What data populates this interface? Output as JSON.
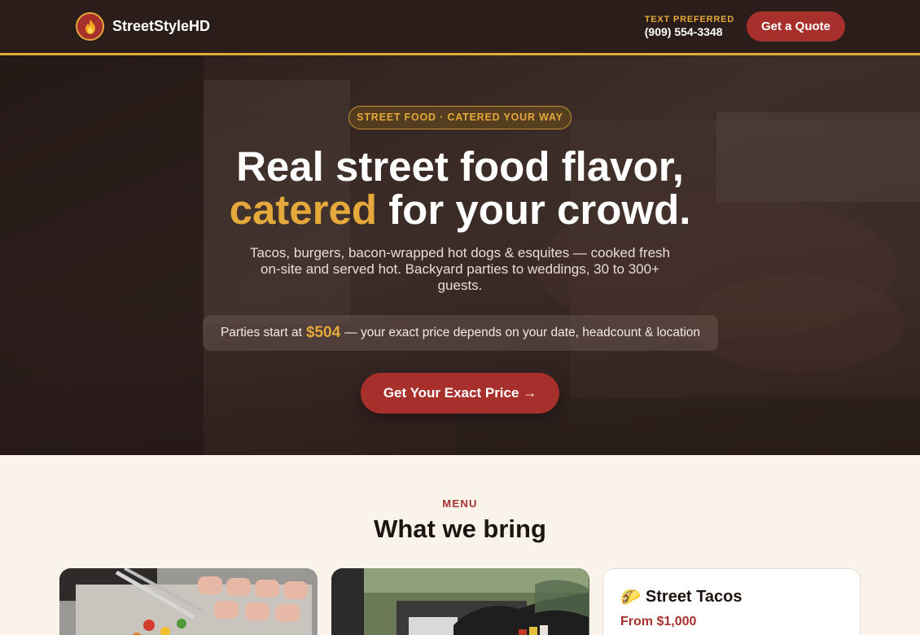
{
  "nav": {
    "brand": "StreetStyleHD",
    "text_label": "TEXT PREFERRED",
    "phone": "(909) 554-3348",
    "quote_button": "Get a Quote"
  },
  "hero": {
    "pill": "STREET FOOD · CATERED YOUR WAY",
    "headline_line1": "Real street food flavor,",
    "headline_accent": "catered",
    "headline_line2_rest": " for your crowd.",
    "subtext": "Tacos, burgers, bacon-wrapped hot dogs & esquites — cooked fresh on-site and served hot. Backyard parties to weddings, 30 to 300+ guests.",
    "price_prefix": "Parties start at",
    "price_amount": "$504",
    "price_suffix": "— your exact price depends on your date, headcount & location",
    "cta": "Get Your Exact Price →"
  },
  "menu": {
    "label": "MENU",
    "title": "What we bring",
    "cards": [
      {
        "type": "image",
        "icon": "grill-food-photo"
      },
      {
        "type": "image",
        "icon": "chef-serving-photo"
      },
      {
        "type": "text",
        "emoji": "🌮",
        "title": "Street Tacos",
        "price": "From $1,000"
      }
    ]
  },
  "colors": {
    "accent": "#e5a83a",
    "brand_red": "#a8302c",
    "nav_bg": "#2b1d1a",
    "page_bg": "#faf3ea"
  }
}
